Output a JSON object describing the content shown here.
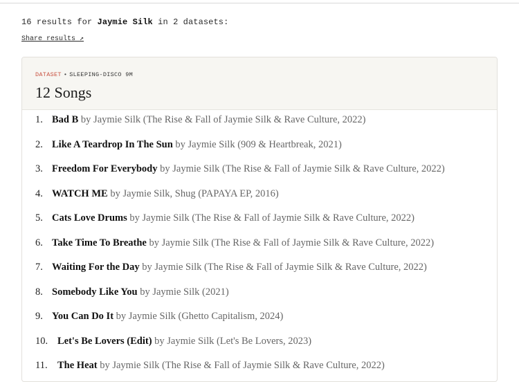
{
  "summary": {
    "count_prefix": "16 results for ",
    "query": "Jaymie Silk",
    "suffix": " in 2 datasets:"
  },
  "share_label": "Share results ↗",
  "dataset": {
    "tag": "DATASET",
    "separator": "•",
    "name": "SLEEPING-DISCO 9M",
    "title": "12 Songs"
  },
  "songs": [
    {
      "num": "1.",
      "title": "Bad B",
      "meta": " by Jaymie Silk (The Rise & Fall of Jaymie Silk & Rave Culture, 2022)"
    },
    {
      "num": "2.",
      "title": "Like A Teardrop In The Sun",
      "meta": " by Jaymie Silk (909 & Heartbreak, 2021)"
    },
    {
      "num": "3.",
      "title": "Freedom For Everybody",
      "meta": " by Jaymie Silk (The Rise & Fall of Jaymie Silk & Rave Culture, 2022)"
    },
    {
      "num": "4.",
      "title": "WATCH ME",
      "meta": " by Jaymie Silk, Shug (PAPAYA EP, 2016)"
    },
    {
      "num": "5.",
      "title": "Cats Love Drums",
      "meta": " by Jaymie Silk (The Rise & Fall of Jaymie Silk & Rave Culture, 2022)"
    },
    {
      "num": "6.",
      "title": "Take Time To Breathe",
      "meta": " by Jaymie Silk (The Rise & Fall of Jaymie Silk & Rave Culture, 2022)"
    },
    {
      "num": "7.",
      "title": "Waiting For the Day",
      "meta": " by Jaymie Silk (The Rise & Fall of Jaymie Silk & Rave Culture, 2022)"
    },
    {
      "num": "8.",
      "title": "Somebody Like You",
      "meta": " by Jaymie Silk (2021)"
    },
    {
      "num": "9.",
      "title": "You Can Do It",
      "meta": " by Jaymie Silk (Ghetto Capitalism, 2024)"
    },
    {
      "num": "10.",
      "title": "Let's Be Lovers (Edit)",
      "meta": " by Jaymie Silk (Let's Be Lovers, 2023)"
    },
    {
      "num": "11.",
      "title": "The Heat",
      "meta": " by Jaymie Silk (The Rise & Fall of Jaymie Silk & Rave Culture, 2022)"
    }
  ]
}
